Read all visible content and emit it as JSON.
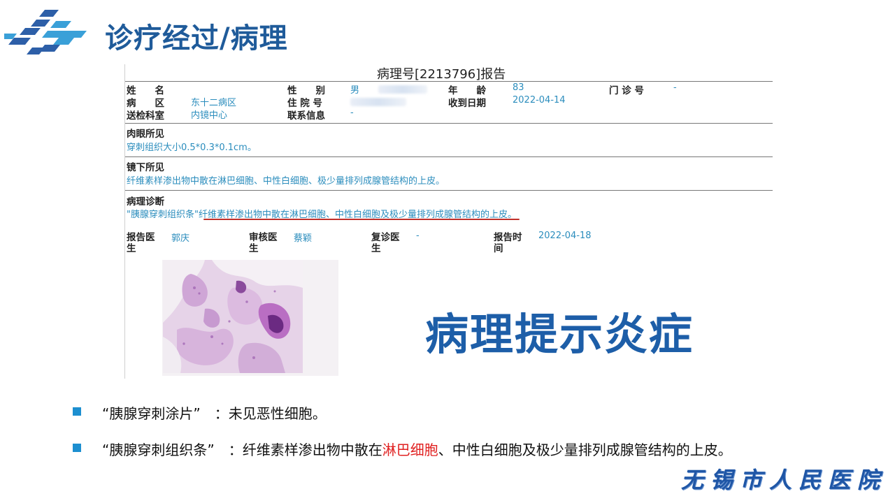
{
  "slide": {
    "title": "诊疗经过/病理"
  },
  "report": {
    "title": "病理号[2213796]报告",
    "fields": {
      "name_label": "姓　　名",
      "gender_label": "性　　别",
      "gender_value": "男",
      "age_label": "年　　龄",
      "age_value": "83",
      "clinic_label": "门 诊 号",
      "clinic_value": "-",
      "ward_label": "病　　区",
      "ward_value": "东十二病区",
      "inpatient_label": "住 院 号",
      "received_label": "收到日期",
      "received_value": "2022-04-14",
      "dept_label": "送检科室",
      "dept_value": "内镜中心",
      "contact_label": "联系信息",
      "contact_value": "-"
    },
    "gross": {
      "heading": "肉眼所见",
      "text": "穿刺组织大小0.5*0.3*0.1cm。"
    },
    "microscopic": {
      "heading": "镜下所见",
      "text": "纤维素样渗出物中散在淋巴细胞、中性白细胞、极少量排列成腺管结构的上皮。"
    },
    "diagnosis": {
      "heading": "病理诊断",
      "text": "\"胰腺穿刺组织条\"纤维素样渗出物中散在淋巴细胞、中性白细胞及极少量排列成腺管结构的上皮。"
    },
    "signoff": {
      "reporter_label": "报告医生",
      "reporter_value": "郭庆",
      "reviewer_label": "审核医生",
      "reviewer_value": "蔡颖",
      "revisit_label": "复诊医生",
      "revisit_value": "-",
      "time_label": "报告时间",
      "time_value": "2022-04-18"
    }
  },
  "callout": "病理提示炎症",
  "bullets": [
    {
      "prefix": "“胰腺穿刺涂片”　：未见恶性细胞。",
      "highlight": "",
      "suffix": ""
    },
    {
      "prefix": "“胰腺穿刺组织条”　：纤维素样渗出物中散在",
      "highlight": "淋巴细胞",
      "suffix": "、中性白细胞及极少量排列成腺管结构的上皮。"
    }
  ],
  "footer": {
    "hospital": "无锡市人民医院"
  },
  "colors": {
    "title": "#1f5b9a",
    "accent": "#1d8fd0",
    "highlight": "#e02020",
    "report_value": "#2b8dbd"
  }
}
